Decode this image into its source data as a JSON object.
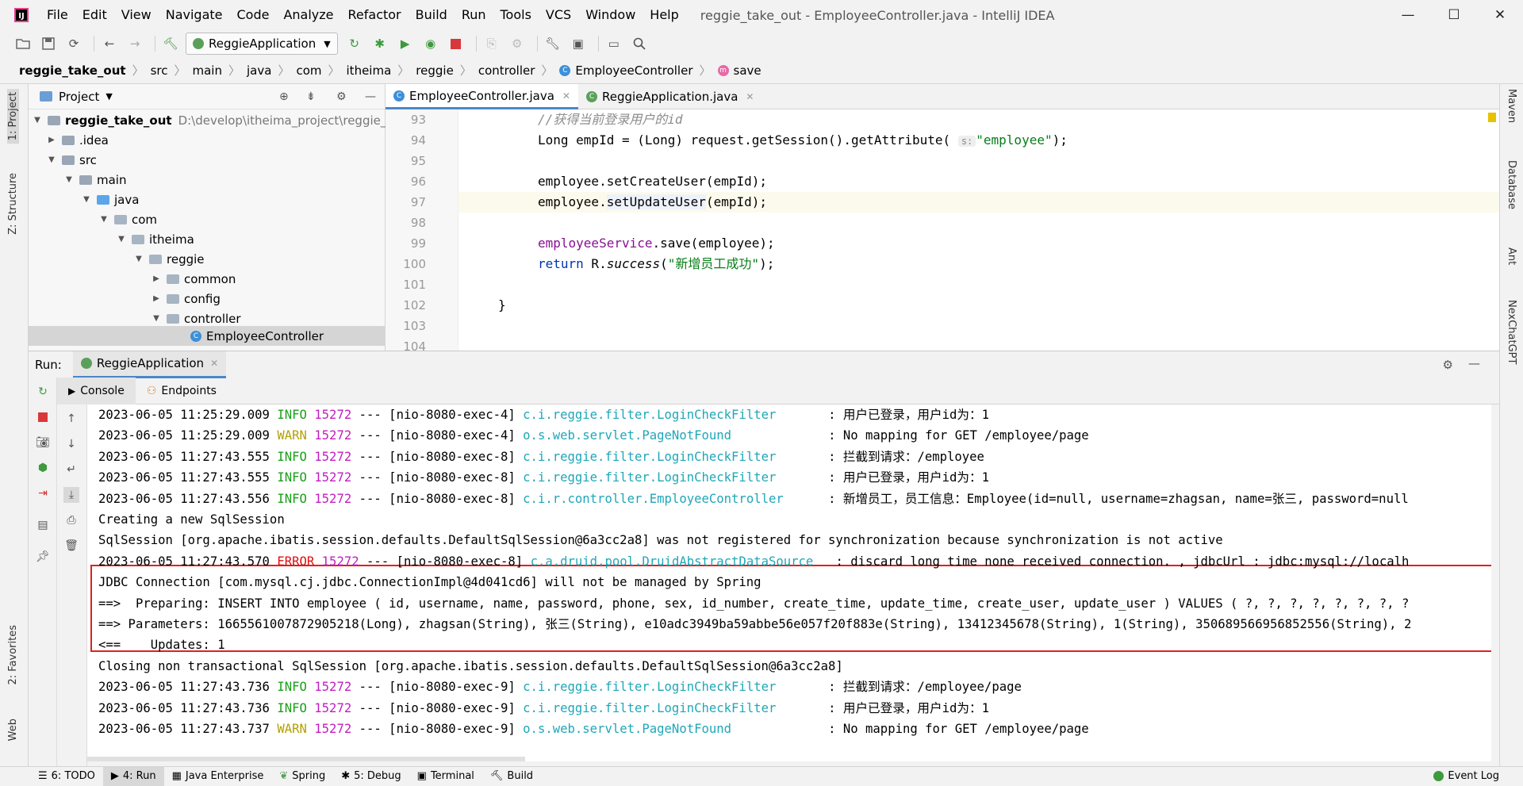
{
  "window": {
    "title": "reggie_take_out - EmployeeController.java - IntelliJ IDEA",
    "controls": [
      "—",
      "☐",
      "✕"
    ]
  },
  "menu": [
    "File",
    "Edit",
    "View",
    "Navigate",
    "Code",
    "Analyze",
    "Refactor",
    "Build",
    "Run",
    "Tools",
    "VCS",
    "Window",
    "Help"
  ],
  "toolbar": {
    "run_config": "ReggieApplication"
  },
  "breadcrumb": [
    "reggie_take_out",
    "src",
    "main",
    "java",
    "com",
    "itheima",
    "reggie",
    "controller",
    "EmployeeController",
    "save"
  ],
  "left_strip": [
    "1: Project",
    "Z: Structure",
    "2: Favorites",
    "Web"
  ],
  "right_strip": [
    "Maven",
    "Database",
    "Ant",
    "NexChatGPT"
  ],
  "project": {
    "header": "Project",
    "tree": [
      {
        "label": "reggie_take_out",
        "path": "D:\\develop\\itheima_project\\reggie_ta",
        "bold": true
      },
      {
        "label": ".idea"
      },
      {
        "label": "src"
      },
      {
        "label": "main"
      },
      {
        "label": "java"
      },
      {
        "label": "com"
      },
      {
        "label": "itheima"
      },
      {
        "label": "reggie"
      },
      {
        "label": "common"
      },
      {
        "label": "config"
      },
      {
        "label": "controller"
      },
      {
        "label": "EmployeeController"
      }
    ]
  },
  "editor": {
    "tabs": [
      "EmployeeController.java",
      "ReggieApplication.java"
    ],
    "line_numbers": [
      "93",
      "94",
      "95",
      "96",
      "97",
      "98",
      "99",
      "100",
      "101",
      "102",
      "103",
      "104"
    ],
    "lines": {
      "l93": "//获得当前登录用户的id",
      "l94a": "Long empId = (Long) request.getSession().getAttribute(",
      "l94hint": "s:",
      "l94str": "\"employee\"",
      "l94end": ");",
      "l96": "employee.setCreateUser(empId);",
      "l97a": "employee.",
      "l97b": "setUpdateUser",
      "l97c": "(empId);",
      "l99a": "employeeService",
      "l99b": ".save(employee);",
      "l100kw": "return",
      "l100a": " R.",
      "l100it": "success",
      "l100b": "(",
      "l100str": "\"新增员工成功\"",
      "l100c": ");",
      "l102": "}"
    }
  },
  "run": {
    "label": "Run:",
    "tab": "ReggieApplication",
    "subtabs": [
      "Console",
      "Endpoints"
    ],
    "console": [
      {
        "ts": "2023-06-05 11:25:29.009",
        "lvl": "INFO",
        "pid": "15272",
        "thr": " --- [nio-8080-exec-4] ",
        "cls": "c.i.reggie.filter.LoginCheckFilter       ",
        "msg": ": 用户已登录，用户id为：1"
      },
      {
        "ts": "2023-06-05 11:25:29.009",
        "lvl": "WARN",
        "pid": "15272",
        "thr": " --- [nio-8080-exec-4] ",
        "cls": "o.s.web.servlet.PageNotFound             ",
        "msg": ": No mapping for GET /employee/page"
      },
      {
        "ts": "2023-06-05 11:27:43.555",
        "lvl": "INFO",
        "pid": "15272",
        "thr": " --- [nio-8080-exec-8] ",
        "cls": "c.i.reggie.filter.LoginCheckFilter       ",
        "msg": ": 拦截到请求：/employee"
      },
      {
        "ts": "2023-06-05 11:27:43.555",
        "lvl": "INFO",
        "pid": "15272",
        "thr": " --- [nio-8080-exec-8] ",
        "cls": "c.i.reggie.filter.LoginCheckFilter       ",
        "msg": ": 用户已登录，用户id为：1"
      },
      {
        "ts": "2023-06-05 11:27:43.556",
        "lvl": "INFO",
        "pid": "15272",
        "thr": " --- [nio-8080-exec-8] ",
        "cls": "c.i.r.controller.EmployeeController      ",
        "msg": ": 新增员工，员工信息：Employee(id=null, username=zhagsan, name=张三, password=null"
      },
      {
        "plain": "Creating a new SqlSession"
      },
      {
        "plain": "SqlSession [org.apache.ibatis.session.defaults.DefaultSqlSession@6a3cc2a8] was not registered for synchronization because synchronization is not active"
      },
      {
        "ts": "2023-06-05 11:27:43.570",
        "lvl": "ERROR",
        "pid": "15272",
        "thr": " --- [nio-8080-exec-8] ",
        "cls": "c.a.druid.pool.DruidAbstractDataSource   ",
        "msg": ": discard long time none received connection. , jdbcUrl : jdbc:mysql://localh"
      },
      {
        "plain": "JDBC Connection [com.mysql.cj.jdbc.ConnectionImpl@4d041cd6] will not be managed by Spring"
      },
      {
        "plain": "==>  Preparing: INSERT INTO employee ( id, username, name, password, phone, sex, id_number, create_time, update_time, create_user, update_user ) VALUES ( ?, ?, ?, ?, ?, ?, ?, ?"
      },
      {
        "plain": "==> Parameters: 1665561007872905218(Long), zhagsan(String), 张三(String), e10adc3949ba59abbe56e057f20f883e(String), 13412345678(String), 1(String), 350689566956852556(String), 2"
      },
      {
        "plain": "<==    Updates: 1"
      },
      {
        "plain": "Closing non transactional SqlSession [org.apache.ibatis.session.defaults.DefaultSqlSession@6a3cc2a8]"
      },
      {
        "ts": "2023-06-05 11:27:43.736",
        "lvl": "INFO",
        "pid": "15272",
        "thr": " --- [nio-8080-exec-9] ",
        "cls": "c.i.reggie.filter.LoginCheckFilter       ",
        "msg": ": 拦截到请求：/employee/page"
      },
      {
        "ts": "2023-06-05 11:27:43.736",
        "lvl": "INFO",
        "pid": "15272",
        "thr": " --- [nio-8080-exec-9] ",
        "cls": "c.i.reggie.filter.LoginCheckFilter       ",
        "msg": ": 用户已登录，用户id为：1"
      },
      {
        "ts": "2023-06-05 11:27:43.737",
        "lvl": "WARN",
        "pid": "15272",
        "thr": " --- [nio-8080-exec-9] ",
        "cls": "o.s.web.servlet.PageNotFound             ",
        "msg": ": No mapping for GET /employee/page"
      }
    ]
  },
  "statusbar": {
    "items": [
      "6: TODO",
      "4: Run",
      "Java Enterprise",
      "Spring",
      "5: Debug",
      "Terminal",
      "Build"
    ],
    "event_log": "Event Log"
  },
  "colors": {
    "accent": "#4a88c7",
    "highlight_box": "#e02020",
    "info": "#1aa01a",
    "warn": "#b4a000",
    "error": "#dd1111"
  }
}
